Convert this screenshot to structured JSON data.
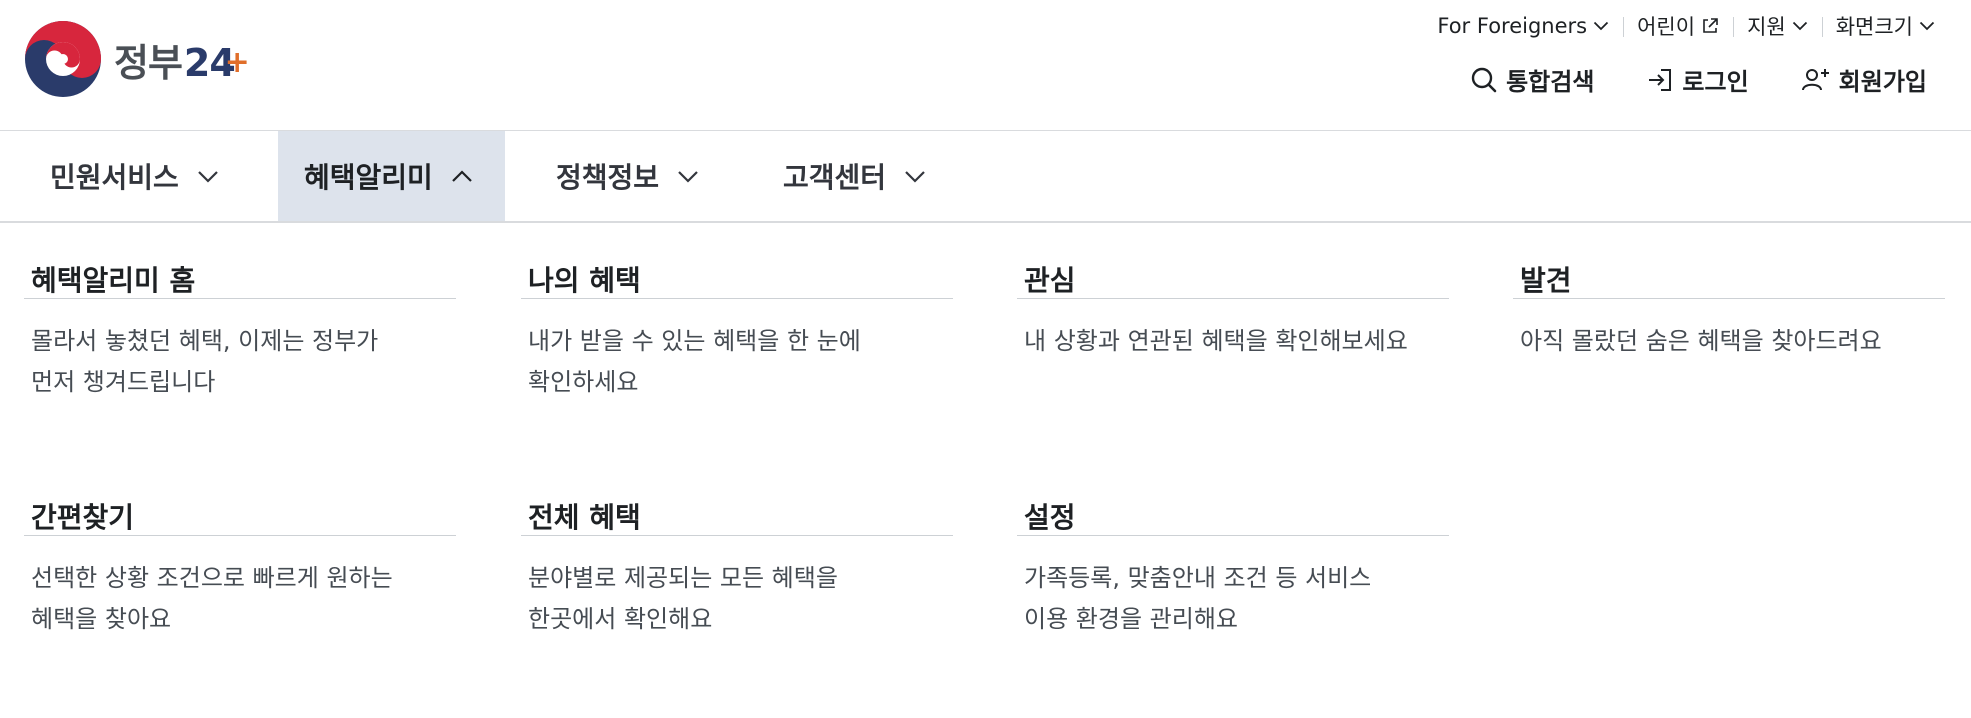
{
  "header": {
    "logo": {
      "ko": "정부",
      "num": "24",
      "plus": "+"
    },
    "utility": [
      {
        "label": "For Foreigners",
        "icon": "chevron-down-icon"
      },
      {
        "label": "어린이",
        "icon": "external-link-icon"
      },
      {
        "label": "지원",
        "icon": "chevron-down-icon"
      },
      {
        "label": "화면크기",
        "icon": "chevron-down-icon"
      }
    ],
    "actions": [
      {
        "label": "통합검색",
        "icon": "search-icon"
      },
      {
        "label": "로그인",
        "icon": "login-icon"
      },
      {
        "label": "회원가입",
        "icon": "user-add-icon"
      }
    ]
  },
  "gnb": {
    "items": [
      {
        "label": "민원서비스",
        "expanded": false
      },
      {
        "label": "혜택알리미",
        "expanded": true
      },
      {
        "label": "정책정보",
        "expanded": false
      },
      {
        "label": "고객센터",
        "expanded": false
      }
    ]
  },
  "megamenu": {
    "items": [
      {
        "title": "혜택알리미 홈",
        "desc": [
          "몰라서 놓쳤던 혜택, 이제는 정부가",
          "먼저 챙겨드립니다"
        ]
      },
      {
        "title": "나의 혜택",
        "desc": [
          "내가 받을 수 있는 혜택을 한 눈에",
          "확인하세요"
        ]
      },
      {
        "title": "관심",
        "desc": [
          "내 상황과 연관된 혜택을 확인해보세요"
        ]
      },
      {
        "title": "발견",
        "desc": [
          "아직 몰랐던 숨은 혜택을 찾아드려요"
        ]
      },
      {
        "title": "간편찾기",
        "desc": [
          "선택한 상황 조건으로 빠르게 원하는",
          "혜택을 찾아요"
        ]
      },
      {
        "title": "전체 혜택",
        "desc": [
          "분야별로 제공되는 모든 혜택을",
          "한곳에서 확인해요"
        ]
      },
      {
        "title": "설정",
        "desc": [
          "가족등록, 맞춤안내 조건 등 서비스",
          "이용 환경을 관리해요"
        ]
      }
    ]
  },
  "colors": {
    "active_tab_bg": "#dde3ec",
    "logo_navy": "#2a3b6a",
    "logo_red": "#d7263d",
    "logo_orange": "#e06e2a"
  }
}
